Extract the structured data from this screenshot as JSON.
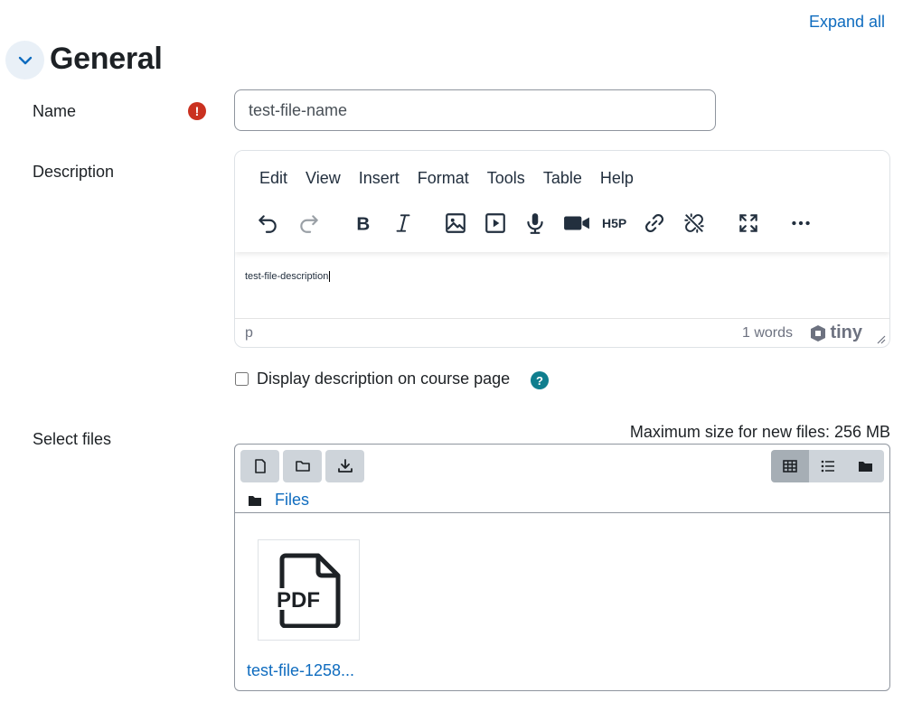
{
  "header": {
    "expand_all": "Expand all",
    "section_title": "General"
  },
  "name_field": {
    "label": "Name",
    "required_mark": "!",
    "value": "test-file-name"
  },
  "description": {
    "label": "Description",
    "menu": [
      "Edit",
      "View",
      "Insert",
      "Format",
      "Tools",
      "Table",
      "Help"
    ],
    "toolbar_icons": [
      "undo-icon",
      "redo-icon",
      "bold-icon",
      "italic-icon",
      "image-icon",
      "media-icon",
      "record-audio-icon",
      "record-video-icon",
      "h5p-icon",
      "link-icon",
      "unlink-icon",
      "fullscreen-icon",
      "more-icon"
    ],
    "content": "test-file-description",
    "status_path": "p",
    "word_count": "1 words",
    "brand": "tiny"
  },
  "display_option": {
    "label": "Display description on course page",
    "checked": false,
    "help": "?"
  },
  "files": {
    "label": "Select files",
    "max_size": "Maximum size for new files: 256 MB",
    "path_label": "Files",
    "file_type_label": "PDF",
    "file_name": "test-file-1258..."
  },
  "colors": {
    "link": "#0f6cbf",
    "required": "#ca3120",
    "help": "#0f7e8e"
  }
}
